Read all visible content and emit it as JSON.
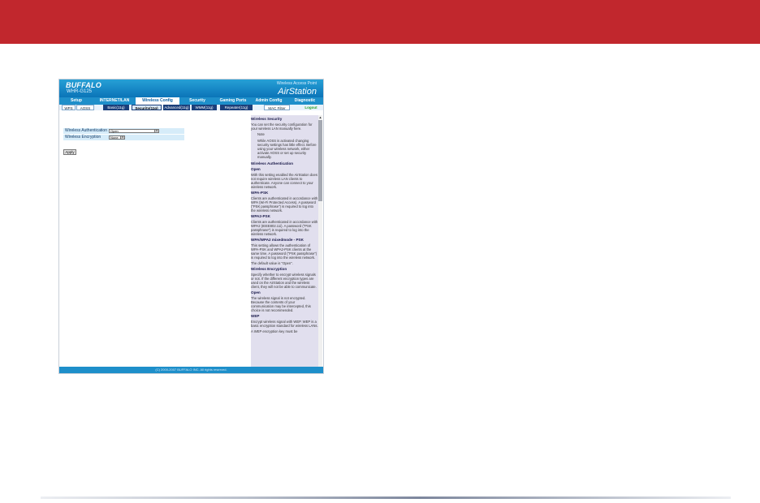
{
  "router": {
    "brand": "BUFFALO",
    "model": "WHR-G125",
    "product_line": "Wireless Access Point",
    "product_name": "AirStation",
    "nav_tabs": [
      "Setup",
      "INTERNET/LAN",
      "Wireless Config",
      "Security",
      "Gaming Ports",
      "Admin Config",
      "Diagnostic"
    ],
    "active_tab": "Wireless Config",
    "subnav": [
      "WPS",
      "AOSS",
      "Basic(11g)",
      "Security(11g)",
      "Advanced(11g)",
      "WMM(11g)",
      "Repeater(11g)",
      "MAC Filter",
      "Logout"
    ],
    "active_subnav": "Security(11g)",
    "form": {
      "auth_label": "Wireless Authentication",
      "auth_value": "Open",
      "enc_label": "Wireless Encryption",
      "enc_value": "None",
      "apply_label": "Apply"
    },
    "help": [
      {
        "type": "heading",
        "text": "Wireless Security"
      },
      {
        "type": "text",
        "text": "You can set the security configuration for your wireless LAN manually here."
      },
      {
        "type": "note",
        "text": "Note"
      },
      {
        "type": "note",
        "text": "While AOSS is activated changing security settings has little effect. Before using your wireless network, either activate AOSS or set up security manually."
      },
      {
        "type": "heading",
        "text": "Wireless Authentication"
      },
      {
        "type": "heading",
        "text": "Open"
      },
      {
        "type": "text",
        "text": "With this setting enabled the AirStation does not require wireless LAN clients to authenticate. Anyone can connect to your wireless network."
      },
      {
        "type": "heading",
        "text": "WPA-PSK"
      },
      {
        "type": "text",
        "text": "Clients are authenticated in accordance with WPA (Wi-Fi Protected Access). A password (\"PSK passphrase\") is required to log into the wireless network."
      },
      {
        "type": "heading",
        "text": "WPA2-PSK"
      },
      {
        "type": "text",
        "text": "Clients are authenticated in accordance with WPA2 (IEEE802.11i). A password (\"PSK passphrase\") is required to log into the wireless network."
      },
      {
        "type": "heading",
        "text": "WPA/WPA2 mixedmode - PSK"
      },
      {
        "type": "text",
        "text": "This setting allows the authentication of WPA-PSK and WPA2-PSK clients at the same time. A password (\"PSK passphrase\") is required to log into the wireless network."
      },
      {
        "type": "text",
        "text": "The default value is \"Open\"."
      },
      {
        "type": "heading",
        "text": "Wireless Encryption"
      },
      {
        "type": "text",
        "text": "Specify whether to encrypt wireless signals or not. If the different encryption types are used on the AirStation and the wireless client, they will not be able to communicate."
      },
      {
        "type": "heading",
        "text": "Open"
      },
      {
        "type": "text",
        "text": "The wireless signal is not encrypted. Because the contents of your communication may be intercepted, this choice is not recommended."
      },
      {
        "type": "heading",
        "text": "WEP"
      },
      {
        "type": "text",
        "text": "Encrypt wireless signal with WEP. WEP is a basic encryption standard for wireless LANs."
      },
      {
        "type": "text",
        "text": "A WEP encryption key must be"
      }
    ],
    "footer": "(C) 2000-2007 BUFFALO INC. All rights reserved."
  },
  "colors": {
    "banner": "#c1272d",
    "router_blue": "#1e8fca",
    "help_panel": "#e1dfee"
  }
}
